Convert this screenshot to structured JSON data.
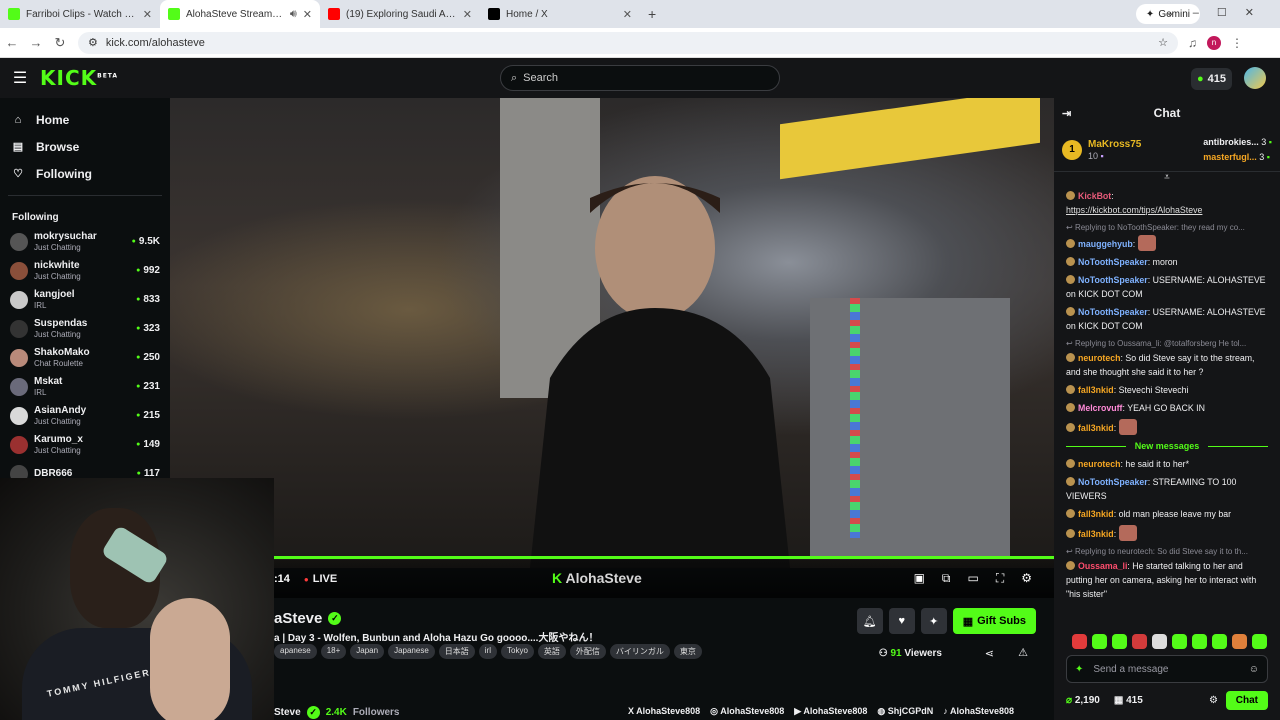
{
  "browser": {
    "tabs": [
      {
        "title": "Farriboi Clips - Watch Live on K",
        "fav": "#53fc18"
      },
      {
        "title": "AlohaSteve Stream - Watch",
        "fav": "#53fc18"
      },
      {
        "title": "(19) Exploring Saudi Arabia UVI",
        "fav": "#ff0000"
      },
      {
        "title": "Home / X",
        "fav": "#000000"
      }
    ],
    "gemini": "Gemini",
    "url": "kick.com/alohasteve",
    "profile_initial": "n"
  },
  "header": {
    "logo": "KICK",
    "logo_sup": "BETA",
    "search_placeholder": "Search",
    "coins": "415"
  },
  "sidebar": {
    "nav": [
      {
        "icon": "⌂",
        "label": "Home"
      },
      {
        "icon": "▤",
        "label": "Browse"
      },
      {
        "icon": "♡",
        "label": "Following"
      }
    ],
    "following_header": "Following",
    "following": [
      {
        "name": "mokrysuchar",
        "cat": "Just Chatting",
        "viewers": "9.5K"
      },
      {
        "name": "nickwhite",
        "cat": "Just Chatting",
        "viewers": "992"
      },
      {
        "name": "kangjoel",
        "cat": "IRL",
        "viewers": "833"
      },
      {
        "name": "Suspendas",
        "cat": "Just Chatting",
        "viewers": "323"
      },
      {
        "name": "ShakoMako",
        "cat": "Chat Roulette",
        "viewers": "250"
      },
      {
        "name": "Mskat",
        "cat": "IRL",
        "viewers": "231"
      },
      {
        "name": "AsianAndy",
        "cat": "Just Chatting",
        "viewers": "215"
      },
      {
        "name": "Karumo_x",
        "cat": "Just Chatting",
        "viewers": "149"
      },
      {
        "name": "DBR666",
        "cat": "",
        "viewers": "117"
      }
    ]
  },
  "player": {
    "time": ":14",
    "live": "LIVE",
    "watermark_k": "K",
    "watermark": "AlohaSteve"
  },
  "stream": {
    "name": "aSteve",
    "title": "a | Day 3  - Wolfen, Bunbun and Aloha Hazu Go goooo....大阪やねん！",
    "tags": [
      "apanese",
      "18+",
      "Japan",
      "Japanese",
      "日本語",
      "irl",
      "Tokyo",
      "英語",
      "外配信",
      "バイリンガル",
      "東京"
    ],
    "gift_label": "Gift Subs",
    "viewers_count": "91",
    "viewers_label": "Viewers",
    "follow_name": "Steve",
    "followers_count": "2.4K",
    "followers_label": "Followers",
    "socials": [
      {
        "icon": "X",
        "label": "AlohaSteve808"
      },
      {
        "icon": "◎",
        "label": "AlohaSteve808"
      },
      {
        "icon": "▶",
        "label": "AlohaSteve808"
      },
      {
        "icon": "◍",
        "label": "ShjCGPdN"
      },
      {
        "icon": "♪",
        "label": "AlohaSteve808"
      }
    ]
  },
  "webcam": {
    "brand": "TOMMY  HILFIGER"
  },
  "chat": {
    "title": "Chat",
    "leader": {
      "rank": "1",
      "name": "MaKross75",
      "count": "10",
      "r1": "antibrokies...",
      "r1c": "3",
      "r2": "masterfugl...",
      "r2c": "3"
    },
    "messages": [
      {
        "user": "KickBot",
        "color": "#e85b7a",
        "text": "",
        "link": "https://kickbot.com/tips/AlohaSteve"
      },
      {
        "reply": "Replying to NoToothSpeaker: they read my co...",
        "user": "mauggehyub",
        "color": "#7fb2ff",
        "emote": true,
        "text": ""
      },
      {
        "user": "NoToothSpeaker",
        "color": "#7fb2ff",
        "text": "moron"
      },
      {
        "user": "NoToothSpeaker",
        "color": "#7fb2ff",
        "text": "USERNAME: ALOHASTEVE on KICK DOT COM"
      },
      {
        "user": "NoToothSpeaker",
        "color": "#7fb2ff",
        "text": "USERNAME: ALOHASTEVE on KICK DOT COM"
      },
      {
        "reply": "Replying to Oussama_li: @totalforsberg He tol...",
        "user": "neurotech",
        "color": "#f5a623",
        "text": "So did Steve say it to the stream, and she thought she said it to her ?"
      },
      {
        "user": "fall3nkid",
        "color": "#f5a623",
        "text": "Stevechi Stevechi"
      },
      {
        "user": "Melcrovuff",
        "color": "#ff8ad8",
        "text": "YEAH GO BACK IN"
      },
      {
        "user": "fall3nkid",
        "color": "#f5a623",
        "text": "",
        "emote": true
      }
    ],
    "new_messages": "New messages",
    "messages2": [
      {
        "user": "neurotech",
        "color": "#f5a623",
        "text": "he said it to her*"
      },
      {
        "user": "NoToothSpeaker",
        "color": "#7fb2ff",
        "text": "STREAMING TO 100 VIEWERS"
      },
      {
        "user": "fall3nkid",
        "color": "#f5a623",
        "text": "old man please leave my bar"
      },
      {
        "user": "fall3nkid",
        "color": "#f5a623",
        "text": "",
        "emote": true
      },
      {
        "reply": "Replying to neurotech: So did Steve say it to th...",
        "user": "Oussama_li",
        "color": "#ff4d6d",
        "text": "He started talking to her and putting her on camera, asking her to interact with \"his sister\""
      }
    ],
    "send_placeholder": "Send a message",
    "points": "2,190",
    "gifts": "415",
    "chat_button": "Chat"
  }
}
